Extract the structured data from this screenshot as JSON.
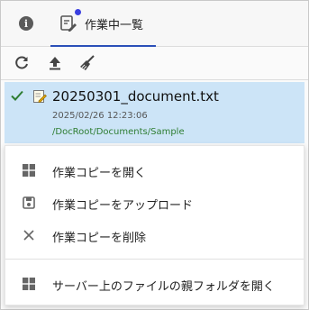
{
  "tabs": {
    "info_icon": "info-icon",
    "worklist_label": "作業中一覧",
    "worklist_icon": "document-edit-icon",
    "accent": "#3a3fe0"
  },
  "toolbar": {
    "icons": [
      "refresh-icon",
      "upload-icon",
      "broom-icon"
    ]
  },
  "file": {
    "name": "20250301_document.txt",
    "modified": "2025/02/26 12:23:06",
    "path": "/DocRoot/Documents/Sample",
    "selected": true
  },
  "menu": {
    "items": [
      {
        "label": "作業コピーを開く",
        "icon": "windows-icon"
      },
      {
        "label": "作業コピーをアップロード",
        "icon": "save-icon"
      },
      {
        "label": "作業コピーを削除",
        "icon": "close-icon"
      },
      {
        "label": "サーバー上のファイルの親フォルダを開く",
        "icon": "windows-icon"
      }
    ]
  },
  "colors": {
    "selection": "#cce4f7",
    "path_text": "#2e7d32",
    "tab_underline": "#2b4fb8"
  }
}
